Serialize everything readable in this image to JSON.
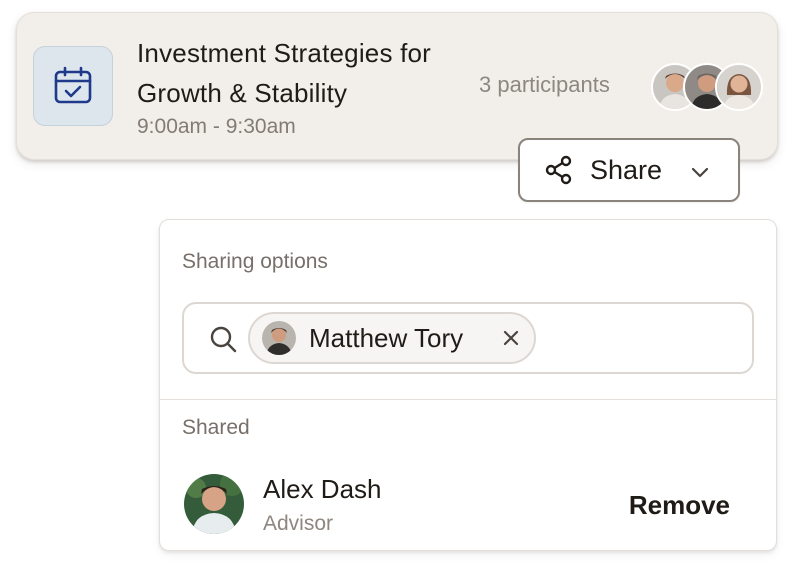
{
  "event": {
    "icon": "calendar-check-icon",
    "title": "Investment Strategies for Growth & Stability",
    "time": "9:00am - 9:30am",
    "participants_label": "3 participants",
    "participants": [
      {
        "avatar": "participant-avatar-1"
      },
      {
        "avatar": "participant-avatar-2"
      },
      {
        "avatar": "participant-avatar-3"
      }
    ]
  },
  "share_button": {
    "label": "Share",
    "icon": "share-icon",
    "chevron": "chevron-down-icon"
  },
  "sharing_panel": {
    "heading": "Sharing options",
    "search": {
      "icon": "search-icon",
      "selected_chip": {
        "label": "Matthew Tory",
        "remove_glyph": "×"
      }
    },
    "shared_heading": "Shared",
    "shared_users": [
      {
        "name": "Alex Dash",
        "role": "Advisor",
        "action_label": "Remove"
      }
    ]
  },
  "colors": {
    "card_bg": "#f2efeb",
    "calendar_bg": "#dde6ed",
    "calendar_icon": "#1f3a8a",
    "text_primary": "#1f1b17",
    "text_muted": "#8e8780"
  }
}
